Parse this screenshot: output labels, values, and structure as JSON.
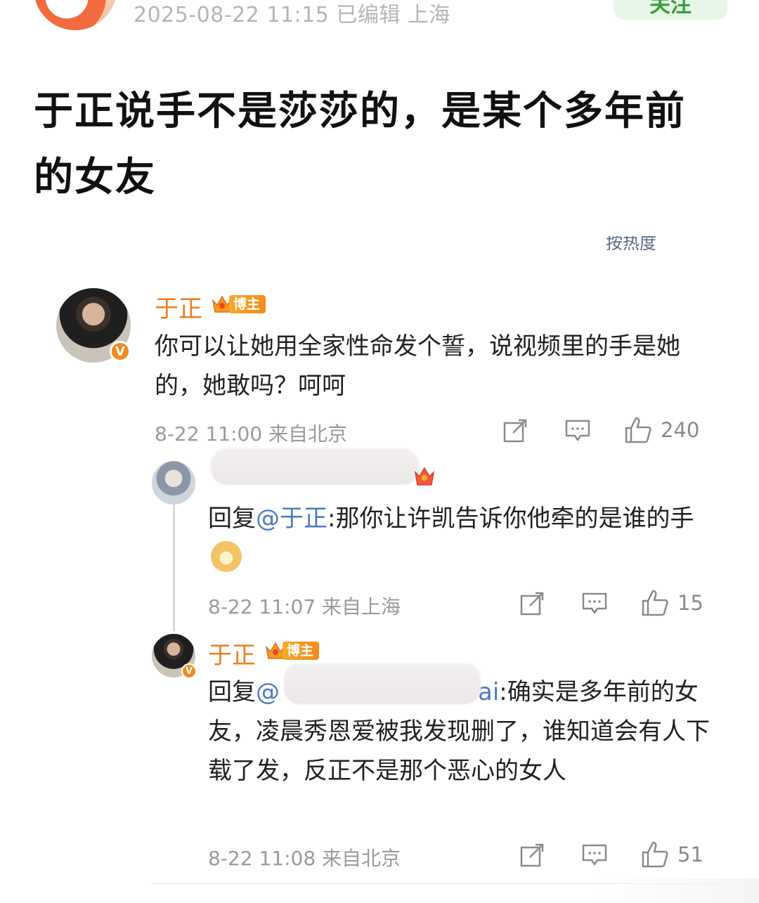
{
  "post": {
    "meta": "2025-08-22 11:15  已编辑  上海",
    "follow_label": "关注",
    "title": "于正说手不是莎莎的，是某个多年前的女友",
    "sort_label": "按热度"
  },
  "comments": [
    {
      "username": "于正",
      "badge_label": "博主",
      "verified_mark": "V",
      "text": "你可以让她用全家性命发个誓，说视频里的手是她的，她敢吗？呵呵",
      "meta": "8-22 11:00 来自北京",
      "likes": "240"
    },
    {
      "reply_prefix": "回复",
      "mention": "@于正",
      "text": ":那你让许凯告诉你他牵的是谁的手",
      "meta": "8-22 11:07 来自上海",
      "likes": "15"
    },
    {
      "username": "于正",
      "badge_label": "博主",
      "verified_mark": "V",
      "reply_prefix": "回复",
      "mention": "@",
      "mention_tail": "ai",
      "text": ":确实是多年前的女友，凌晨秀恩爱被我发现删了，谁知道会有人下载了发，反正不是那个恶心的女人",
      "meta": "8-22 11:08 来自北京",
      "likes": "51"
    }
  ],
  "colors": {
    "username": "#f07d1e",
    "mention": "#4b7bbf",
    "follow_bg": "#e8f6e8",
    "follow_text": "#36a13a",
    "meta_grey": "#9a9a9a"
  },
  "icons": [
    "forward-icon",
    "comment-icon",
    "like-icon",
    "crown-icon",
    "verified-icon",
    "doge-emoji-icon"
  ]
}
